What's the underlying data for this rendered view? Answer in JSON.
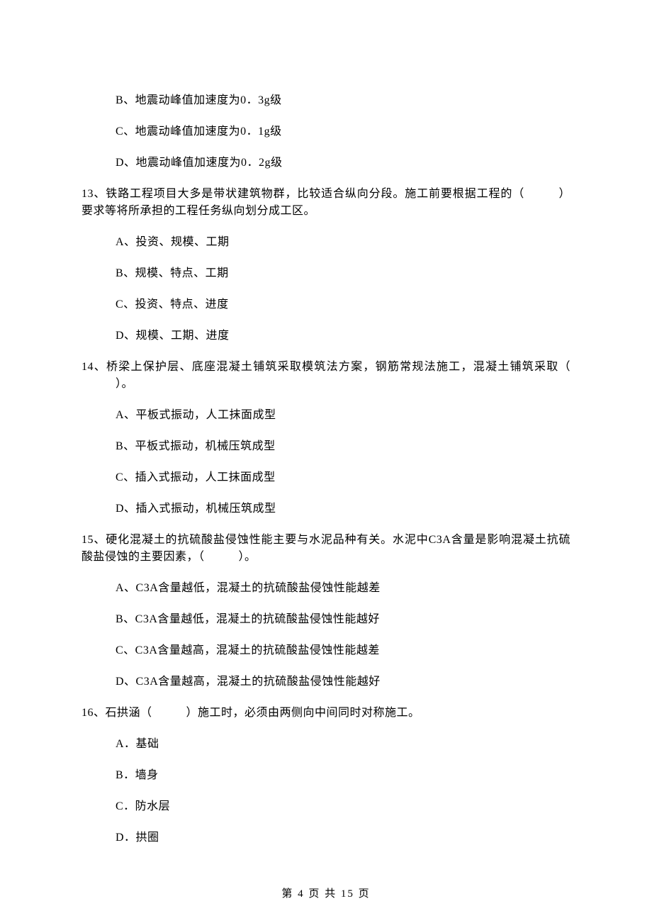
{
  "q12": {
    "opts": {
      "B": "B、地震动峰值加速度为0．3g级",
      "C": "C、地震动峰值加速度为0．1g级",
      "D": "D、地震动峰值加速度为0．2g级"
    }
  },
  "q13": {
    "stem_pre": "13、铁路工程项目大多是带状建筑物群，比较适合纵向分段。施工前要根据工程的（",
    "stem_post": "）要求等将所承担的工程任务纵向划分成工区。",
    "opts": {
      "A": "A、投资、规模、工期",
      "B": "B、规模、特点、工期",
      "C": "C、投资、特点、进度",
      "D": "D、规模、工期、进度"
    }
  },
  "q14": {
    "stem_pre": "14、桥梁上保护层、底座混凝土铺筑采取模筑法方案，钢筋常规法施工，混凝土铺筑采取（",
    "stem_post": "）。",
    "opts": {
      "A": "A、平板式振动，人工抹面成型",
      "B": "B、平板式振动，机械压筑成型",
      "C": "C、插入式振动，人工抹面成型",
      "D": "D、插入式振动，机械压筑成型"
    }
  },
  "q15": {
    "stem_pre": "15、硬化混凝土的抗硫酸盐侵蚀性能主要与水泥品种有关。水泥中C3A含量是影响混凝土抗硫酸盐侵蚀的主要因素，（",
    "stem_post": "）。",
    "opts": {
      "A": "A、C3A含量越低，混凝土的抗硫酸盐侵蚀性能越差",
      "B": "B、C3A含量越低，混凝土的抗硫酸盐侵蚀性能越好",
      "C": "C、C3A含量越高，混凝土的抗硫酸盐侵蚀性能越差",
      "D": "D、C3A含量越高，混凝土的抗硫酸盐侵蚀性能越好"
    }
  },
  "q16": {
    "stem_pre": "16、石拱涵（",
    "stem_post": "）施工时，必须由两侧向中间同时对称施工。",
    "opts": {
      "A": "A．基础",
      "B": "B．墙身",
      "C": "C．防水层",
      "D": "D．拱圈"
    }
  },
  "footer": "第 4 页 共 15 页"
}
